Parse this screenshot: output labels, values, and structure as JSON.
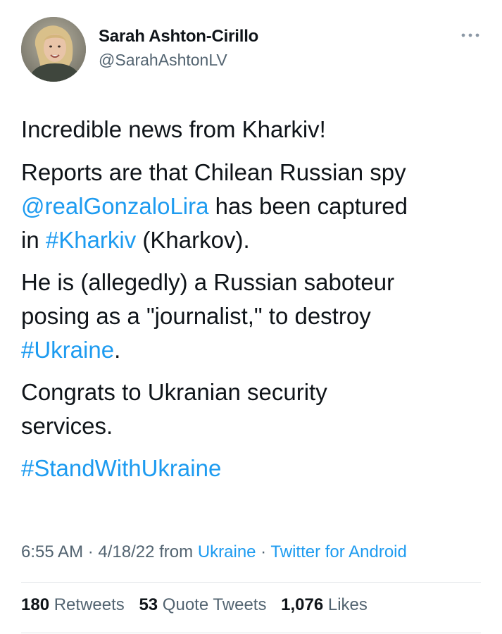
{
  "author": {
    "display_name": "Sarah Ashton-Cirillo",
    "handle": "@SarahAshtonLV",
    "avatar_icon": "profile-photo",
    "more_icon": "more-horizontal-icon"
  },
  "tweet": {
    "p1": "Incredible news from Kharkiv!",
    "p2_a": "Reports are that   Chilean Russian spy",
    "p2_mention": "@realGonzaloLira",
    "p2_b": " has been captured",
    "p2_c": "in ",
    "p2_hashtag": "#Kharkiv",
    "p2_d": " (Kharkov).",
    "p3_a": "He is (allegedly) a  Russian saboteur",
    "p3_b": "posing as a \"journalist,\" to destroy",
    "p3_hashtag": "#Ukraine",
    "p3_c": ".",
    "p4_a": "Congrats to Ukranian security",
    "p4_b": "services.",
    "p5_hashtag": "#StandWithUkraine"
  },
  "meta": {
    "time": "6:55 AM",
    "sep1": " · ",
    "date": "4/18/22",
    "from_label": " from ",
    "location": "Ukraine",
    "sep2": " · ",
    "client": "Twitter for Android"
  },
  "stats": {
    "retweets_count": "180",
    "retweets_label": " Retweets",
    "quote_count": "53",
    "quote_label": " Quote Tweets",
    "likes_count": "1,076",
    "likes_label": " Likes"
  },
  "colors": {
    "link": "#1d9bf0",
    "text": "#0f1419",
    "secondary": "#536471"
  }
}
